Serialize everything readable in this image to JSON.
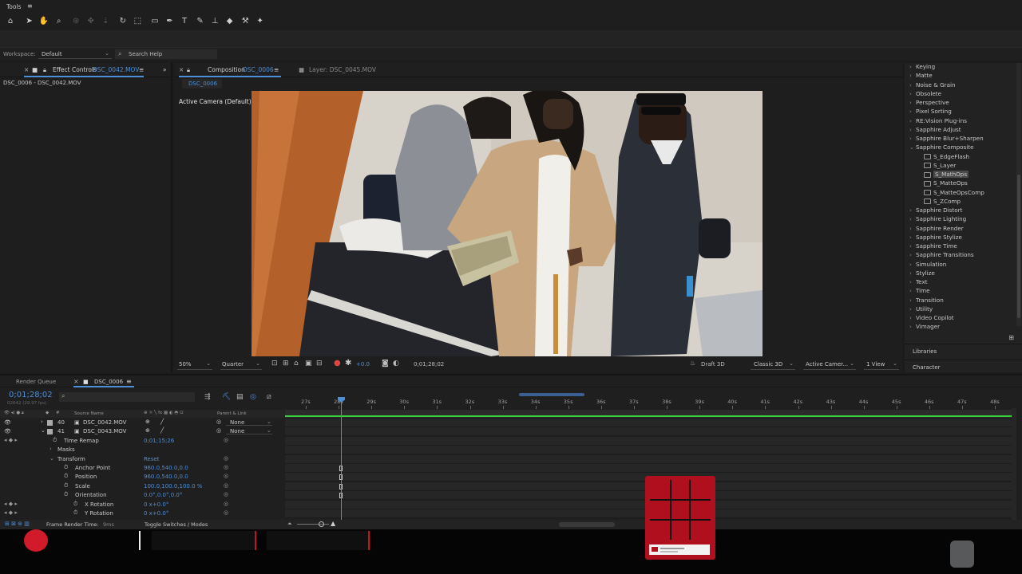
{
  "menubar": {
    "title": "Tools",
    "menu_icon": "≡"
  },
  "workspace": {
    "label": "Workspace:",
    "value": "Default",
    "search_placeholder": "Search Help"
  },
  "effect_controls": {
    "tab_label": "Effect Controls",
    "tab_file": "DSC_0042.MOV",
    "subtitle": "DSC_0006 - DSC_0042.MOV"
  },
  "composition": {
    "tab_label": "Composition",
    "tab_comp": "DSC_0006",
    "layer_tab": "Layer: DSC_0045.MOV",
    "breadcrumb": "DSC_0006",
    "camera_label": "Active Camera (Default)",
    "zoom": "50%",
    "resolution": "Quarter",
    "exposure": "+0.0",
    "timecode": "0;01;28;02",
    "renderer": "Draft 3D",
    "render_mode": "Classic 3D",
    "camera_select": "Active Camer...",
    "views": "1 View"
  },
  "effects_list": [
    {
      "label": "Keying",
      "type": "group"
    },
    {
      "label": "Matte",
      "type": "group"
    },
    {
      "label": "Noise & Grain",
      "type": "group"
    },
    {
      "label": "Obsolete",
      "type": "group"
    },
    {
      "label": "Perspective",
      "type": "group"
    },
    {
      "label": "Pixel Sorting",
      "type": "group"
    },
    {
      "label": "RE:Vision Plug-ins",
      "type": "group"
    },
    {
      "label": "Sapphire Adjust",
      "type": "group"
    },
    {
      "label": "Sapphire Blur+Sharpen",
      "type": "group"
    },
    {
      "label": "Sapphire Composite",
      "type": "open"
    },
    {
      "label": "S_EdgeFlash",
      "type": "item"
    },
    {
      "label": "S_Layer",
      "type": "item"
    },
    {
      "label": "S_MathOps",
      "type": "selected"
    },
    {
      "label": "S_MatteOps",
      "type": "item"
    },
    {
      "label": "S_MatteOpsComp",
      "type": "item"
    },
    {
      "label": "S_ZComp",
      "type": "item"
    },
    {
      "label": "Sapphire Distort",
      "type": "group"
    },
    {
      "label": "Sapphire Lighting",
      "type": "group"
    },
    {
      "label": "Sapphire Render",
      "type": "group"
    },
    {
      "label": "Sapphire Stylize",
      "type": "group"
    },
    {
      "label": "Sapphire Time",
      "type": "group"
    },
    {
      "label": "Sapphire Transitions",
      "type": "group"
    },
    {
      "label": "Simulation",
      "type": "group"
    },
    {
      "label": "Stylize",
      "type": "group"
    },
    {
      "label": "Text",
      "type": "group"
    },
    {
      "label": "Time",
      "type": "group"
    },
    {
      "label": "Transition",
      "type": "group"
    },
    {
      "label": "Utility",
      "type": "group"
    },
    {
      "label": "Video Copilot",
      "type": "group"
    },
    {
      "label": "Vimager",
      "type": "group"
    }
  ],
  "right_panels": {
    "libraries": "Libraries",
    "character": "Character"
  },
  "timeline": {
    "render_queue_tab": "Render Queue",
    "comp_tab": "DSC_0006",
    "timecode": "0;01;28;02",
    "timecode_sub": "02642 (29.97 fps)",
    "col_source": "Source Name",
    "col_parent": "Parent & Link",
    "ticks": [
      "27s",
      "28s",
      "29s",
      "30s",
      "31s",
      "32s",
      "33s",
      "34s",
      "35s",
      "36s",
      "37s",
      "38s",
      "39s",
      "40s",
      "41s",
      "42s",
      "43s",
      "44s",
      "45s",
      "46s",
      "47s",
      "48s"
    ],
    "layers": [
      {
        "num": "40",
        "name": "DSC_0042.MOV",
        "parent": "None"
      },
      {
        "num": "41",
        "name": "DSC_0043.MOV",
        "parent": "None"
      }
    ],
    "props": [
      {
        "label": "Time Remap",
        "value": "0;01;15;26"
      },
      {
        "label": "Masks",
        "value": ""
      },
      {
        "label": "Transform",
        "value": "Reset"
      },
      {
        "label": "Anchor Point",
        "value": "960.0,540.0,0.0"
      },
      {
        "label": "Position",
        "value": "960.0,540.0,0.0"
      },
      {
        "label": "Scale",
        "value": "100.0,100.0,100.0 %"
      },
      {
        "label": "Orientation",
        "value": "0.0°,0.0°,0.0°"
      },
      {
        "label": "X Rotation",
        "value": "0 x+0.0°"
      },
      {
        "label": "Y Rotation",
        "value": "0 x+0.0°"
      }
    ],
    "frame_render": "Frame Render Time:",
    "frame_render_val": "9ms",
    "toggle": "Toggle Switches / Modes"
  },
  "colors": {
    "accent": "#4d8ed8",
    "track_green": "#3ad03a",
    "overlay_red": "#c01525"
  }
}
